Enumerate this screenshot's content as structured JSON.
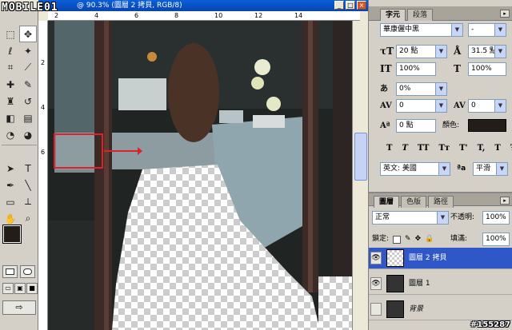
{
  "logo": {
    "text": "MOBILE01"
  },
  "document": {
    "title": "@ 90.3% (圖層 2 拷貝, RGB/8)",
    "win_buttons": [
      "_",
      "□",
      "×"
    ],
    "ruler_top": [
      "2",
      "4",
      "6",
      "8",
      "10",
      "12",
      "14"
    ],
    "ruler_left": [
      "2",
      "4",
      "6"
    ]
  },
  "toolbox": {
    "tools": [
      {
        "name": "marquee-tool",
        "glyph": "⬚"
      },
      {
        "name": "move-tool",
        "glyph": "✥"
      },
      {
        "name": "lasso-tool",
        "glyph": "ℓ"
      },
      {
        "name": "magic-wand-tool",
        "glyph": "✦"
      },
      {
        "name": "crop-tool",
        "glyph": "⌗"
      },
      {
        "name": "slice-tool",
        "glyph": "⟋"
      },
      {
        "name": "healing-brush-tool",
        "glyph": "✚"
      },
      {
        "name": "brush-tool",
        "glyph": "✎"
      },
      {
        "name": "clone-stamp-tool",
        "glyph": "♜"
      },
      {
        "name": "history-brush-tool",
        "glyph": "↺"
      },
      {
        "name": "eraser-tool",
        "glyph": "◧"
      },
      {
        "name": "gradient-tool",
        "glyph": "▤"
      },
      {
        "name": "blur-tool",
        "glyph": "◔"
      },
      {
        "name": "dodge-tool",
        "glyph": "◕"
      },
      {
        "name": "path-select-tool",
        "glyph": "➤"
      },
      {
        "name": "type-tool",
        "glyph": "T"
      },
      {
        "name": "pen-tool",
        "glyph": "✒"
      },
      {
        "name": "line-tool",
        "glyph": "╲"
      },
      {
        "name": "notes-tool",
        "glyph": "▭"
      },
      {
        "name": "eyedropper-tool",
        "glyph": "⟂"
      },
      {
        "name": "hand-tool",
        "glyph": "✋"
      },
      {
        "name": "zoom-tool",
        "glyph": "⌕"
      }
    ],
    "colors": {
      "foreground": "#241c16",
      "background": "#000000"
    }
  },
  "character_panel": {
    "tabs": [
      "字元",
      "段落"
    ],
    "font_family": "華康儷中黑",
    "font_style": "-",
    "font_size": "20 點",
    "leading": "31.5 點",
    "vertical_scale": "100%",
    "horizontal_scale": "100%",
    "tsume": "0%",
    "tracking": "0",
    "baseline_shift": "0 點",
    "color_label": "顏色:",
    "color": "#241c16",
    "styles": [
      "T",
      "T",
      "TT",
      "Tт",
      "T'",
      "T,",
      "T",
      "Ŧ"
    ],
    "language": "英文: 美國",
    "aa_label": "ªa",
    "antialias": "平滑"
  },
  "layers_panel": {
    "tabs": [
      "圖層",
      "色版",
      "路徑"
    ],
    "blend_mode": "正常",
    "opacity_label": "不透明:",
    "opacity": "100%",
    "lock_label": "鎖定:",
    "fill_label": "填滿:",
    "fill": "100%",
    "layers": [
      {
        "name": "圖層 2 拷貝",
        "selected": true,
        "visible": true
      },
      {
        "name": "圖層 1",
        "selected": false,
        "visible": true
      },
      {
        "name": "背景",
        "selected": false,
        "visible": false
      }
    ]
  },
  "watermark": "#155287"
}
